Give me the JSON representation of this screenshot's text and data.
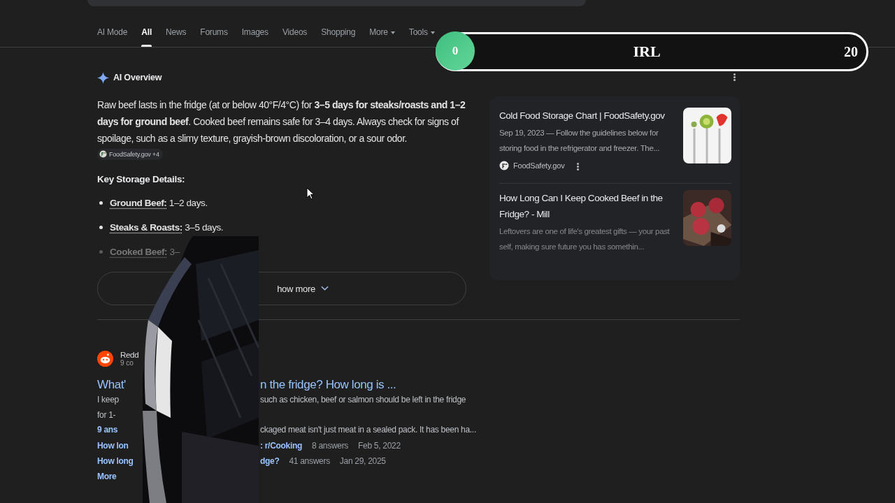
{
  "tabs": [
    {
      "label": "AI Mode",
      "selected": false,
      "dropdown": false
    },
    {
      "label": "All",
      "selected": true,
      "dropdown": false
    },
    {
      "label": "News",
      "selected": false,
      "dropdown": false
    },
    {
      "label": "Forums",
      "selected": false,
      "dropdown": false
    },
    {
      "label": "Images",
      "selected": false,
      "dropdown": false
    },
    {
      "label": "Videos",
      "selected": false,
      "dropdown": false
    },
    {
      "label": "Shopping",
      "selected": false,
      "dropdown": false
    },
    {
      "label": "More",
      "selected": false,
      "dropdown": true
    },
    {
      "label": "Tools",
      "selected": false,
      "dropdown": true
    }
  ],
  "score_bar": {
    "start": "0",
    "title": "IRL",
    "end": "20"
  },
  "ai_overview": {
    "title": "AI Overview",
    "summary": "Raw beef lasts in the fridge (at or below 40°F/4°C) for **3–5 days for steaks/roasts and 1–2 days for ground beef**. Cooked beef remains safe for 3–4 days. Always check for signs of spoilage, such as a slimy texture, grayish-brown discoloration, or a sour odor.",
    "source_chip": "FoodSafety.gov +4",
    "heading": "Key Storage Details:",
    "bullets": [
      {
        "term": "Ground Beef:",
        "text": "1–2 days.",
        "faded": false
      },
      {
        "term": "Steaks & Roasts:",
        "text": "3–5 days.",
        "faded": false
      },
      {
        "term": "Cooked Beef:",
        "text": "3–",
        "faded": true
      }
    ],
    "show_more": "how more"
  },
  "sources": [
    {
      "title": "Cold Food Storage Chart | FoodSafety.gov",
      "snippet": "Sep 19, 2023 — Follow the guidelines below for storing food in the refrigerator and freezer. The...",
      "site": "FoodSafety.gov",
      "faded": false
    },
    {
      "title": "How Long Can I Keep Cooked Beef in the Fridge? - Mill",
      "snippet": "Leftovers are one of life's greatest gifts — your past self, making sure future you has somethin...",
      "faded": true
    }
  ],
  "result": {
    "source": "Redd",
    "meta": "9 co",
    "title": [
      "What'",
      "n the fridge? How long is ..."
    ],
    "lines": [
      {
        "left": "I keep",
        "right": "such as chicken, beef or salmon should be left in the fridge"
      },
      {
        "left": "for 1-"
      },
      {
        "left": "9 ans",
        "right": "ckaged meat isn't just meat in a sealed pack. It has been ha...",
        "kind": "answer"
      }
    ],
    "related": [
      {
        "left": "How lon",
        "right": ": r/Cooking",
        "answers": "8 answers",
        "date": "Feb 5, 2022"
      },
      {
        "left": "How long",
        "right": "dge?",
        "answers": "41 answers",
        "date": "Jan 29, 2025"
      }
    ],
    "more": "More"
  }
}
